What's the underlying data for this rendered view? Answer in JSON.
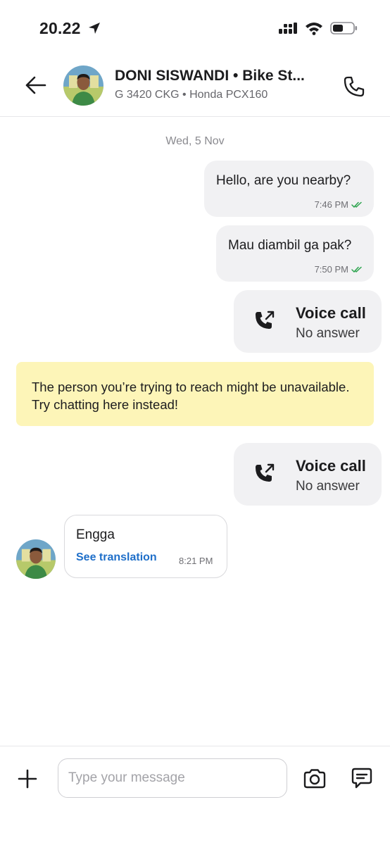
{
  "status_bar": {
    "time": "20.22"
  },
  "header": {
    "contact_name": "DONI SISWANDI • Bike St...",
    "vehicle_info": "G 3420 CKG • Honda PCX160"
  },
  "chat": {
    "date_separator": "Wed, 5 Nov",
    "outgoing": [
      {
        "text": "Hello, are you nearby?",
        "time": "7:46 PM"
      },
      {
        "text": "Mau diambil ga pak?",
        "time": "7:50 PM"
      }
    ],
    "voice_calls": [
      {
        "title": "Voice call",
        "status": "No answer"
      },
      {
        "title": "Voice call",
        "status": "No answer"
      }
    ],
    "notice": "The person you’re trying to reach might be unavailable. Try chatting here instead!",
    "incoming": {
      "text": "Engga",
      "translate_label": "See translation",
      "time": "8:21 PM"
    }
  },
  "composer": {
    "placeholder": "Type your message"
  },
  "colors": {
    "notice_bg": "#fdf5b8",
    "link": "#1f6fc9",
    "read_tick": "#2ea44f",
    "bubble_bg": "#f1f1f3"
  },
  "icons": [
    "location-arrow-icon",
    "signal-icon",
    "wifi-icon",
    "battery-icon",
    "back-arrow-icon",
    "phone-icon",
    "outgoing-call-icon",
    "read-ticks-icon",
    "plus-icon",
    "camera-icon",
    "quick-reply-icon"
  ]
}
